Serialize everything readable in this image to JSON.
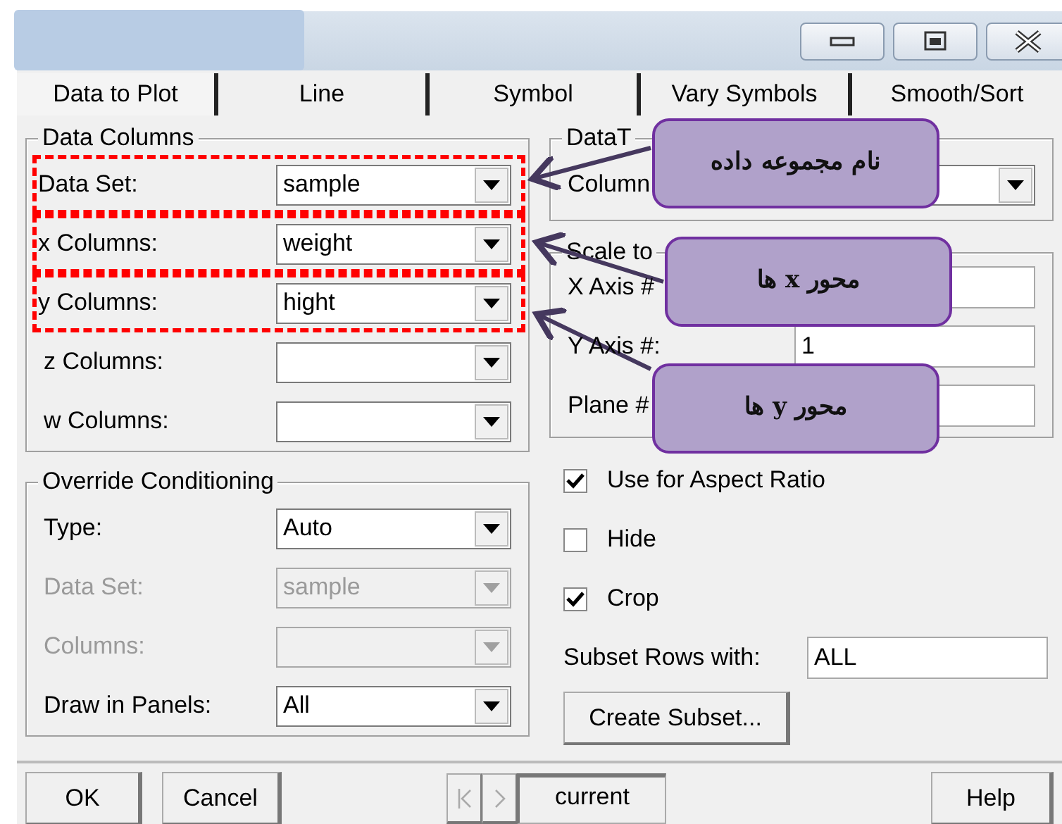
{
  "tabs": [
    {
      "label": "Data to Plot",
      "selected": true
    },
    {
      "label": "Line",
      "selected": false
    },
    {
      "label": "Symbol",
      "selected": false
    },
    {
      "label": "Vary Symbols",
      "selected": false
    },
    {
      "label": "Smooth/Sort",
      "selected": false
    }
  ],
  "data_columns": {
    "title": "Data Columns",
    "rows": [
      {
        "label": "Data Set:",
        "value": "sample",
        "highlighted": true
      },
      {
        "label": "x Columns:",
        "value": "weight",
        "highlighted": true
      },
      {
        "label": "y Columns:",
        "value": "hight",
        "highlighted": true
      },
      {
        "label": "z Columns:",
        "highlighted": false
      },
      {
        "label": "w Columns:",
        "highlighted": false
      }
    ]
  },
  "override_conditioning": {
    "title": "Override Conditioning",
    "rows": [
      {
        "label": "Type:",
        "value": "Auto",
        "disabled": false
      },
      {
        "label": "Data Set:",
        "value": "sample",
        "disabled": true
      },
      {
        "label": "Columns:",
        "disabled": true
      },
      {
        "label": "Draw in Panels:",
        "value": "All",
        "disabled": false
      }
    ]
  },
  "data_type": {
    "title": "DataT",
    "label": "Column"
  },
  "scale_to": {
    "title": "Scale to",
    "rows": [
      {
        "label": "X Axis #"
      },
      {
        "label": "Y Axis #:",
        "value": "1"
      },
      {
        "label": "Plane #"
      }
    ]
  },
  "checkboxes": [
    {
      "label": "Use for Aspect Ratio",
      "checked": true
    },
    {
      "label": "Hide",
      "checked": false
    },
    {
      "label": "Crop",
      "checked": true
    }
  ],
  "subset": {
    "label": "Subset Rows with:",
    "value": "ALL",
    "button": "Create Subset..."
  },
  "footer": {
    "buttons": [
      "OK",
      "Cancel"
    ],
    "current": "current",
    "help": "Help"
  },
  "callouts": [
    {
      "text": "نام مجموعه داده"
    },
    {
      "text": "محور x ها"
    },
    {
      "text": "محور y ها"
    }
  ]
}
